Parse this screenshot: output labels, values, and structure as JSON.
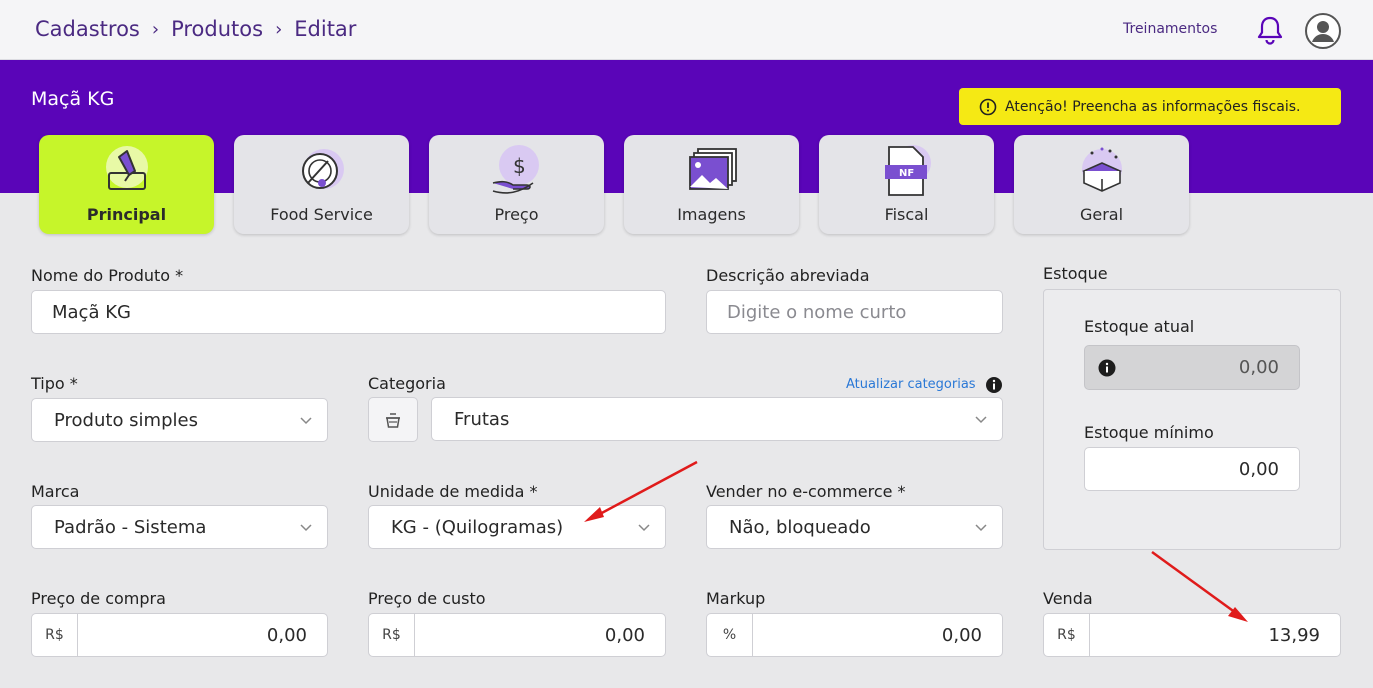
{
  "breadcrumb": [
    "Cadastros",
    "Produtos",
    "Editar"
  ],
  "header": {
    "training_link": "Treinamentos"
  },
  "icons": {
    "notifications": "bell-icon",
    "user": "user-avatar-icon"
  },
  "product": {
    "title": "Maçã KG"
  },
  "alert": {
    "text": "Atenção! Preencha as informações fiscais.",
    "color": "#f5e914"
  },
  "colors": {
    "brand": "#5a05b8",
    "active_tab": "#c6f52a",
    "link": "#2a78d6",
    "annotation_arrow": "#e01b1b"
  },
  "tabs": [
    {
      "label": "Principal",
      "icon": "pencil-edit-icon",
      "active": true
    },
    {
      "label": "Food Service",
      "icon": "plate-cutlery-icon",
      "active": false
    },
    {
      "label": "Preço",
      "icon": "hand-money-icon",
      "active": false
    },
    {
      "label": "Imagens",
      "icon": "photos-icon",
      "active": false
    },
    {
      "label": "Fiscal",
      "icon": "nf-document-icon",
      "active": false
    },
    {
      "label": "Geral",
      "icon": "gift-box-icon",
      "active": false
    }
  ],
  "form": {
    "nome": {
      "label": "Nome do Produto *",
      "value": "Maçã KG"
    },
    "descricao": {
      "label": "Descrição abreviada",
      "placeholder": "Digite o nome curto"
    },
    "tipo": {
      "label": "Tipo *",
      "value": "Produto simples"
    },
    "categoria": {
      "label": "Categoria",
      "value": "Frutas",
      "update_link": "Atualizar categorias"
    },
    "marca": {
      "label": "Marca",
      "value": "Padrão - Sistema"
    },
    "unidade": {
      "label": "Unidade de medida *",
      "value": "KG - (Quilogramas)"
    },
    "ecommerce": {
      "label": "Vender no e-commerce *",
      "value": "Não, bloqueado"
    },
    "preco_compra": {
      "label": "Preço de compra",
      "prefix": "R$",
      "value": "0,00"
    },
    "preco_custo": {
      "label": "Preço de custo",
      "prefix": "R$",
      "value": "0,00"
    },
    "markup": {
      "label": "Markup",
      "prefix": "%",
      "value": "0,00"
    },
    "venda": {
      "label": "Venda",
      "prefix": "R$",
      "value": "13,99"
    }
  },
  "estoque": {
    "title": "Estoque",
    "atual": {
      "label": "Estoque atual",
      "value": "0,00"
    },
    "minimo": {
      "label": "Estoque mínimo",
      "value": "0,00"
    }
  }
}
